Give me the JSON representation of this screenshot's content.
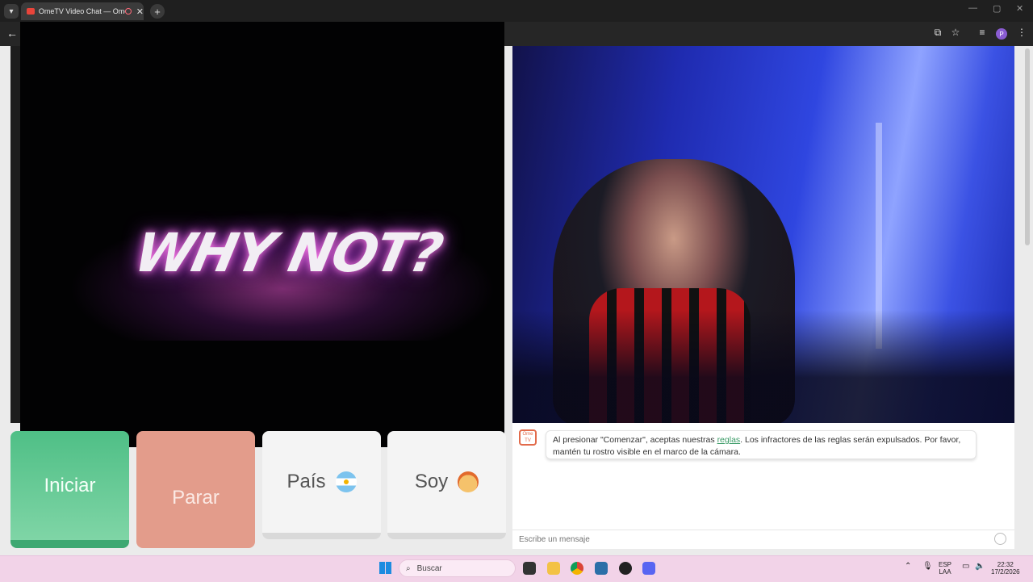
{
  "browser": {
    "tab_title": "OmeTV Video Chat — Ome",
    "close_glyph": "✕",
    "new_tab_glyph": "+",
    "menu_glyph": "⋮"
  },
  "remote_video": {
    "overlay_text": "WHY NOT?"
  },
  "controls": {
    "start_label": "Iniciar",
    "stop_label": "Parar",
    "country_label": "País",
    "gender_label": "Soy"
  },
  "chat": {
    "logo_text": "Ome TV",
    "notice_before_link": "Al presionar \"Comenzar\", aceptas nuestras ",
    "notice_link": "reglas",
    "notice_after_link": ". Los infractores de las reglas serán expulsados. Por favor, mantén tu rostro visible en el marco de la cámara.",
    "input_placeholder": "Escribe un mensaje"
  },
  "taskbar": {
    "search_placeholder": "Buscar",
    "lang_top": "ESP",
    "lang_bottom": "LAA",
    "time": "22:32",
    "date": "17/2/2026"
  },
  "colors": {
    "start_green": "#4fbf86",
    "stop_salmon": "#e39c8b",
    "link_green": "#3a9a66",
    "taskbar_pink": "#f2d3e8"
  }
}
